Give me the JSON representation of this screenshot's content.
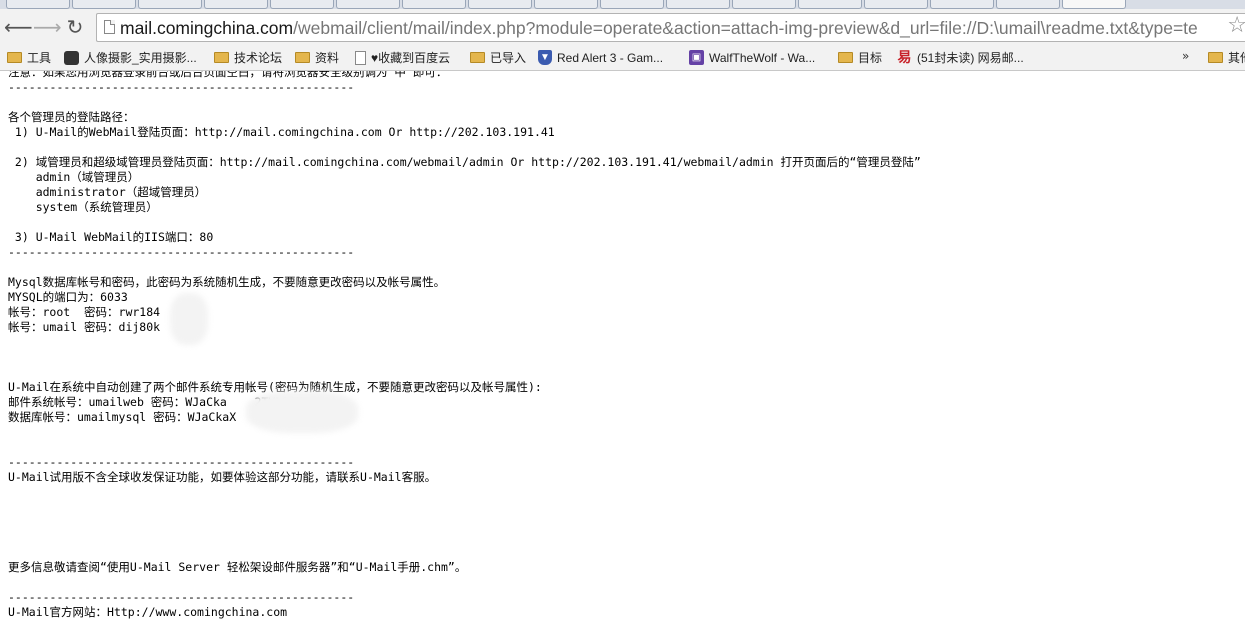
{
  "browser": {
    "url_host": "mail.comingchina.com",
    "url_path": "/webmail/client/mail/index.php?module=operate&action=attach-img-preview&d_url=file://D:\\umail\\readme.txt&type=te",
    "tabs_visible": 17
  },
  "bookmarks": [
    {
      "icon": "folder-icon",
      "label": "工具"
    },
    {
      "icon": "camera-icon",
      "label": "人像摄影_实用摄影..."
    },
    {
      "icon": "folder-icon",
      "label": "技术论坛"
    },
    {
      "icon": "folder-icon",
      "label": "资料"
    },
    {
      "icon": "document-icon",
      "label": "♥收藏到百度云"
    },
    {
      "icon": "folder-icon",
      "label": "已导入"
    },
    {
      "icon": "shield-icon",
      "label": "Red Alert 3 - Gam..."
    },
    {
      "icon": "twitch-icon",
      "label": "WalfTheWolf - Wa..."
    },
    {
      "icon": "folder-icon",
      "label": "目标"
    },
    {
      "icon": "mail163-icon",
      "label": "(51封未读) 网易邮..."
    },
    {
      "icon": "folder-icon",
      "label": "其他"
    }
  ],
  "overflow_label": "»",
  "document_lines": [
    "注意：如果您用浏览器登录前台或后台页面空白，请将浏览器安全级别调为“中”即可：",
    "--------------------------------------------------",
    "",
    "各个管理员的登陆路径：",
    " 1) U-Mail的WebMail登陆页面：http://mail.comingchina.com Or http://202.103.191.41",
    "",
    " 2) 域管理员和超级域管理员登陆页面：http://mail.comingchina.com/webmail/admin Or http://202.103.191.41/webmail/admin 打开页面后的“管理员登陆”",
    "    admin（域管理员）",
    "    administrator（超域管理员）",
    "    system（系统管理员）",
    "",
    " 3) U-Mail WebMail的IIS端口：80",
    "--------------------------------------------------",
    "",
    "Mysql数据库帐号和密码，此密码为系统随机生成，不要随意更改密码以及帐号属性。",
    "MYSQL的端口为：6033",
    "帐号：root  密码：rwr184",
    "帐号：umail 密码：dij80k",
    "",
    "",
    "",
    "U-Mail在系统中自动创建了两个邮件系统专用帐号(密码为随机生成，不要随意更改密码以及帐号属性):",
    "邮件系统帐号：umailweb 密码：WJaCka    2TVL20H",
    "数据库帐号：umailmysql 密码：WJaCkaX",
    "",
    "",
    "--------------------------------------------------",
    "U-Mail试用版不含全球收发保证功能，如要体验这部分功能，请联系U-Mail客服。",
    "",
    "",
    "",
    "",
    "",
    "更多信息敬请查阅“使用U-Mail Server 轻松架设邮件服务器”和“U-Mail手册.chm”。",
    "",
    "--------------------------------------------------",
    "U-Mail官方网站：Http://www.comingchina.com"
  ]
}
